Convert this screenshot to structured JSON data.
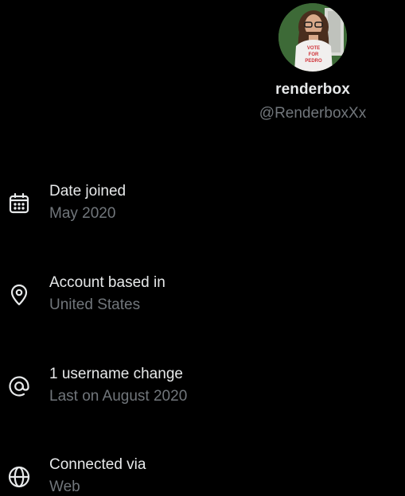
{
  "profile": {
    "display_name": "renderbox",
    "handle": "@RenderboxXx",
    "avatar_shirt_text": [
      "VOTE",
      "FOR",
      "PEDRO"
    ]
  },
  "about": {
    "items": [
      {
        "icon": "calendar-icon",
        "title": "Date joined",
        "subtitle": "May 2020"
      },
      {
        "icon": "location-pin-icon",
        "title": "Account based in",
        "subtitle": "United States"
      },
      {
        "icon": "at-sign-icon",
        "title": "1 username change",
        "subtitle": "Last on August 2020"
      },
      {
        "icon": "globe-icon",
        "title": "Connected via",
        "subtitle": "Web"
      }
    ]
  },
  "colors": {
    "background": "#000000",
    "primary_text": "#e7e9ea",
    "secondary_text": "#71767b",
    "avatar_bg": "#3d6a37"
  }
}
